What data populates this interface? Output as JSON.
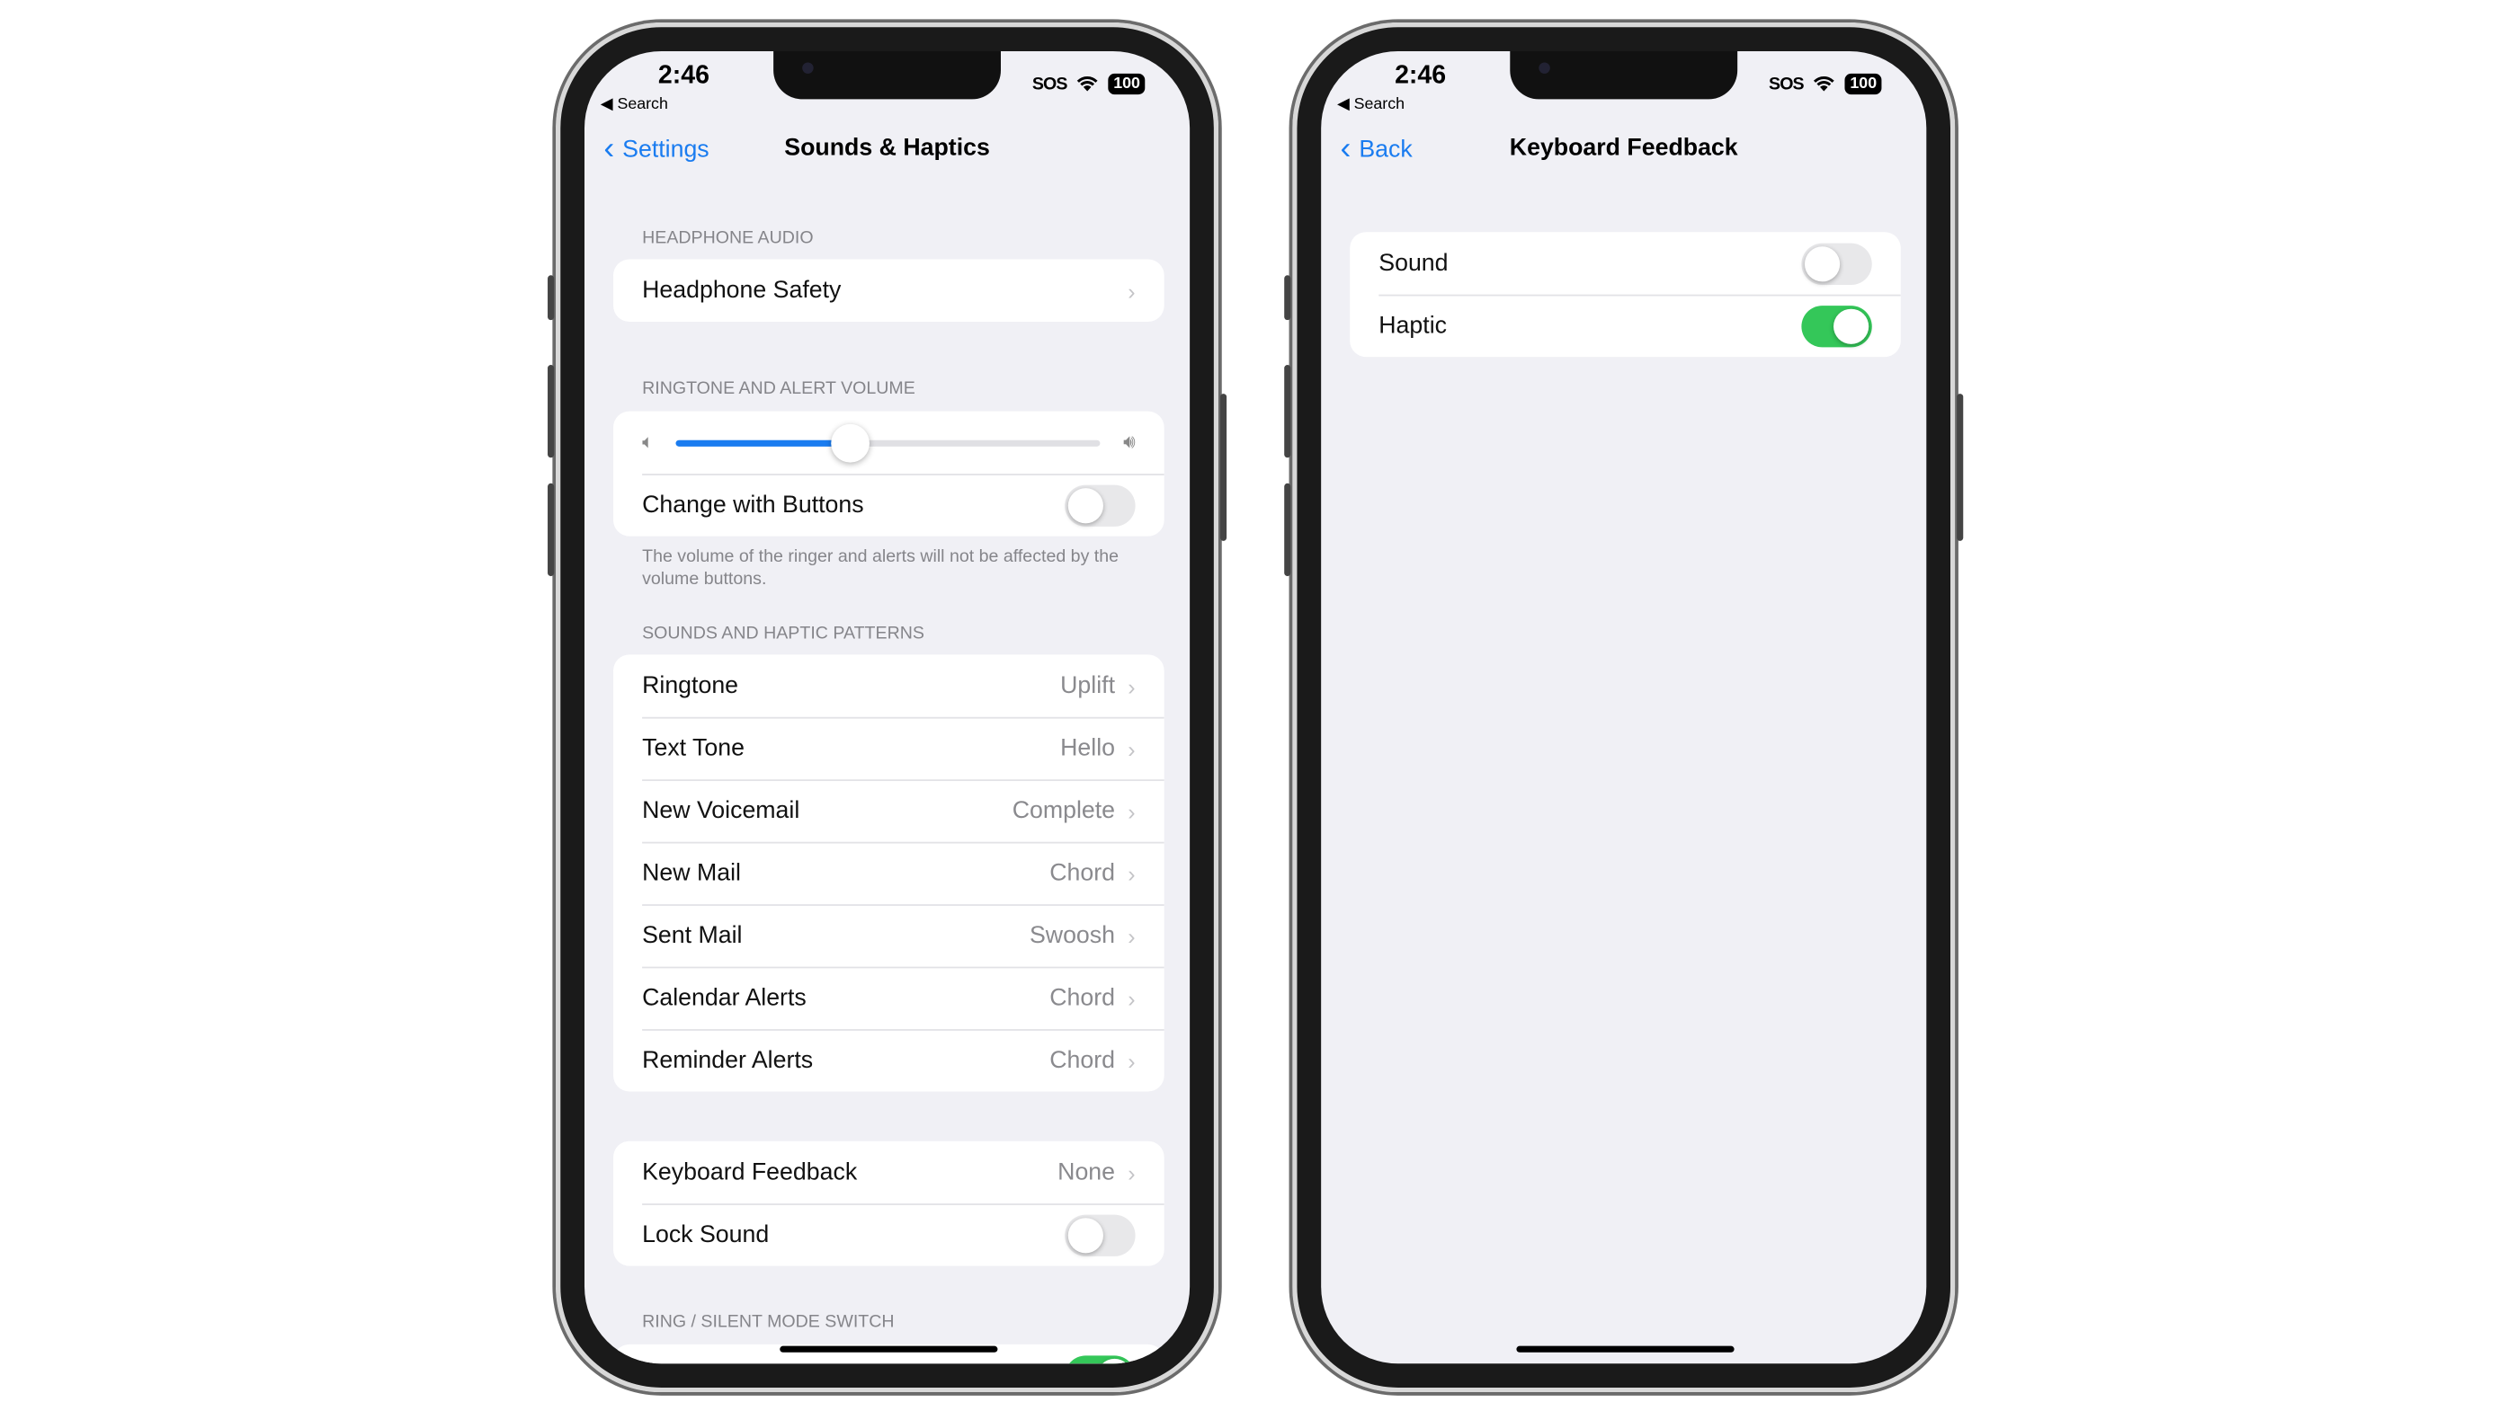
{
  "colors": {
    "accent": "#1a7cf0",
    "toggle_on": "#34c759"
  },
  "status": {
    "time": "2:46",
    "back_app": "◀ Search",
    "carrier": "SOS",
    "battery": "100"
  },
  "left": {
    "nav": {
      "back": "Settings",
      "title": "Sounds & Haptics"
    },
    "headphone": {
      "label": "HEADPHONE AUDIO",
      "row": "Headphone Safety"
    },
    "ringtone_volume": {
      "label": "RINGTONE AND ALERT VOLUME",
      "level_percent": 41,
      "change_with_buttons": "Change with Buttons",
      "change_with_buttons_on": false,
      "footnote": "The volume of the ringer and alerts will not be affected by the volume buttons."
    },
    "patterns": {
      "label": "SOUNDS AND HAPTIC PATTERNS",
      "items": [
        {
          "name": "Ringtone",
          "value": "Uplift"
        },
        {
          "name": "Text Tone",
          "value": "Hello"
        },
        {
          "name": "New Voicemail",
          "value": "Complete"
        },
        {
          "name": "New Mail",
          "value": "Chord"
        },
        {
          "name": "Sent Mail",
          "value": "Swoosh"
        },
        {
          "name": "Calendar Alerts",
          "value": "Chord"
        },
        {
          "name": "Reminder Alerts",
          "value": "Chord"
        }
      ]
    },
    "keyboard": {
      "name": "Keyboard Feedback",
      "value": "None"
    },
    "lock_sound": {
      "name": "Lock Sound",
      "on": false
    },
    "ring_silent": {
      "label": "RING / SILENT MODE SWITCH",
      "on": true
    }
  },
  "right": {
    "nav": {
      "back": "Back",
      "title": "Keyboard Feedback"
    },
    "items": [
      {
        "name": "Sound",
        "on": false
      },
      {
        "name": "Haptic",
        "on": true
      }
    ]
  }
}
